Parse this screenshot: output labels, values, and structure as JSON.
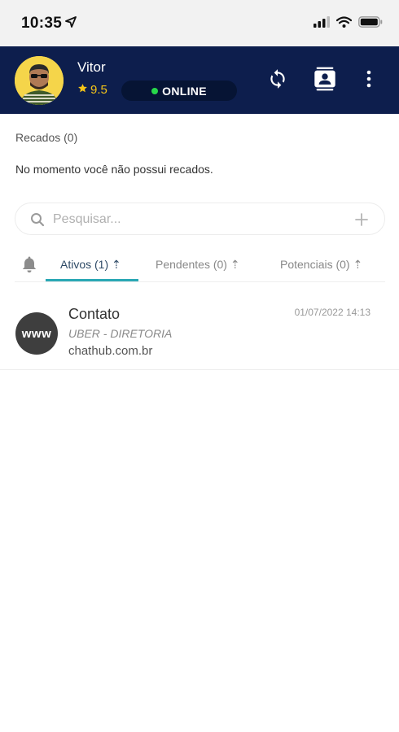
{
  "status_bar": {
    "time": "10:35",
    "icons": [
      "location-arrow-icon",
      "cellular-signal-icon",
      "wifi-icon",
      "battery-icon"
    ]
  },
  "header": {
    "user_name": "Vitor",
    "rating": "9.5",
    "status": "ONLINE",
    "status_color": "#27d84a",
    "background_color": "#0d1e4d",
    "buttons": [
      "refresh-icon",
      "contacts-icon",
      "more-vertical-icon"
    ]
  },
  "recados": {
    "title": "Recados (0)",
    "empty_message": "No momento você não possui recados."
  },
  "search": {
    "placeholder": "Pesquisar...",
    "value": ""
  },
  "tabs": [
    {
      "label": "Ativos (1) ⇡",
      "active": true
    },
    {
      "label": "Pendentes (0) ⇡",
      "active": false
    },
    {
      "label": "Potenciais (0) ⇡",
      "active": false
    }
  ],
  "accent_color": "#2aa8b5",
  "contacts": [
    {
      "avatar_text": "www",
      "name": "Contato",
      "company": "UBER - DIRETORIA",
      "source": "chathub.com.br",
      "timestamp": "01/07/2022 14:13"
    }
  ]
}
